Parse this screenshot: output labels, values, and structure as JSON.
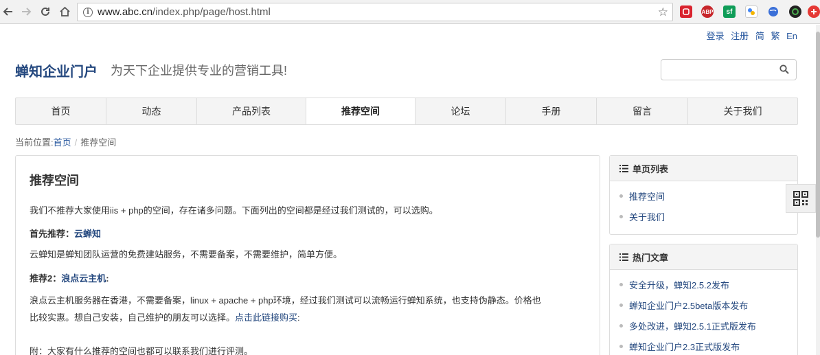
{
  "browser": {
    "url_host": "www.abc.cn",
    "url_path": "/index.php/page/host.html",
    "extensions": [
      "ABP",
      "sf"
    ]
  },
  "toplinks": [
    "登录",
    "注册",
    "简",
    "繁",
    "En"
  ],
  "header": {
    "brand": "蝉知企业门户",
    "slogan": "为天下企业提供专业的营销工具!"
  },
  "nav": {
    "items": [
      "首页",
      "动态",
      "产品列表",
      "推荐空间",
      "论坛",
      "手册",
      "留言",
      "关于我们"
    ],
    "active": "推荐空间"
  },
  "breadcrumb": {
    "prefix": "当前位置:",
    "home": "首页",
    "current": "推荐空间"
  },
  "article": {
    "title": "推荐空间",
    "intro": "我们不推荐大家使用iis + php的空间，存在诸多问题。下面列出的空间都是经过我们测试的，可以选购。",
    "rec1_label": "首先推荐：",
    "rec1_link": "云蝉知",
    "rec1_desc": "云蝉知是蝉知团队运营的免费建站服务，不需要备案，不需要维护，简单方便。",
    "rec2_label": "推荐2：",
    "rec2_link": "浪点云主机",
    "rec2_colon": ":",
    "rec2_desc_line1": "浪点云主机服务器在香港，不需要备案，linux + apache + php环境，经过我们测试可以流畅运行蝉知系统，也支持伪静态。价格也",
    "rec2_desc_line2": "比较实惠。想自己安装，自己维护的朋友可以选择。",
    "rec2_buy_link": "点击此链接购买",
    "rec2_desc_end": ":",
    "footnote": "附：大家有什么推荐的空间也都可以联系我们进行评测。"
  },
  "sidebar": {
    "pages": {
      "title": "单页列表",
      "items": [
        "推荐空间",
        "关于我们"
      ]
    },
    "hot": {
      "title": "热门文章",
      "items": [
        "安全升级，蝉知2.5.2发布",
        "蝉知企业门户2.5beta版本发布",
        "多处改进，蝉知2.5.1正式版发布",
        "蝉知企业门户2.3正式版发布"
      ]
    }
  },
  "colors": {
    "brand": "#23477e",
    "link": "#2b5aa0"
  }
}
